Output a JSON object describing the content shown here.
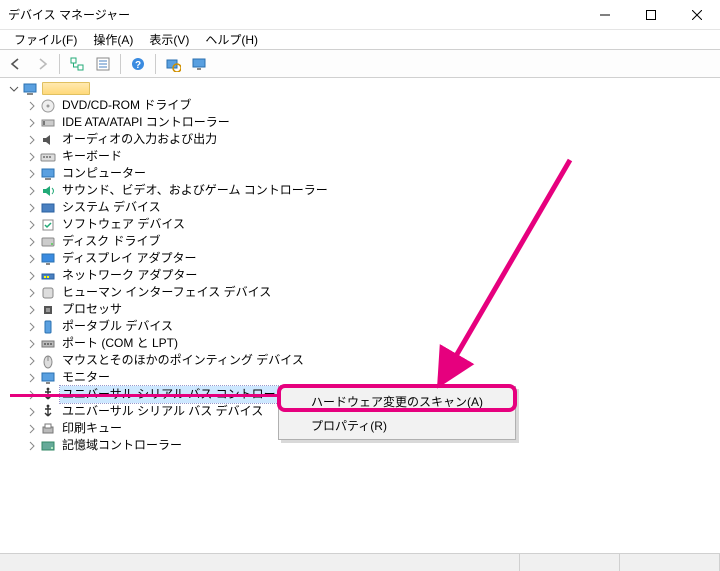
{
  "window": {
    "title": "デバイス マネージャー"
  },
  "menu": {
    "file": "ファイル(F)",
    "action": "操作(A)",
    "view": "表示(V)",
    "help": "ヘルプ(H)"
  },
  "toolbar": {
    "back": "back",
    "forward": "forward",
    "up": "up",
    "show_hidden": "show-hidden",
    "properties": "properties",
    "scan": "scan-hardware",
    "monitor": "monitor"
  },
  "tree": {
    "root": "",
    "items": [
      {
        "label": "DVD/CD-ROM ドライブ",
        "icon": "disc"
      },
      {
        "label": "IDE ATA/ATAPI コントローラー",
        "icon": "ide"
      },
      {
        "label": "オーディオの入力および出力",
        "icon": "audio"
      },
      {
        "label": "キーボード",
        "icon": "keyboard"
      },
      {
        "label": "コンピューター",
        "icon": "computer"
      },
      {
        "label": "サウンド、ビデオ、およびゲーム コントローラー",
        "icon": "sound"
      },
      {
        "label": "システム デバイス",
        "icon": "system"
      },
      {
        "label": "ソフトウェア デバイス",
        "icon": "software"
      },
      {
        "label": "ディスク ドライブ",
        "icon": "disk"
      },
      {
        "label": "ディスプレイ アダプター",
        "icon": "display"
      },
      {
        "label": "ネットワーク アダプター",
        "icon": "network"
      },
      {
        "label": "ヒューマン インターフェイス デバイス",
        "icon": "hid"
      },
      {
        "label": "プロセッサ",
        "icon": "cpu"
      },
      {
        "label": "ポータブル デバイス",
        "icon": "portable"
      },
      {
        "label": "ポート (COM と LPT)",
        "icon": "port"
      },
      {
        "label": "マウスとそのほかのポインティング デバイス",
        "icon": "mouse"
      },
      {
        "label": "モニター",
        "icon": "monitor"
      },
      {
        "label": "ユニバーサル シリアル バス コントローラー",
        "icon": "usb",
        "selected": true
      },
      {
        "label": "ユニバーサル シリアル バス デバイス",
        "icon": "usb"
      },
      {
        "label": "印刷キュー",
        "icon": "printer"
      },
      {
        "label": "記憶域コントローラー",
        "icon": "storage"
      }
    ]
  },
  "context_menu": {
    "scan": "ハードウェア変更のスキャン(A)",
    "properties": "プロパティ(R)"
  },
  "annotation": {
    "color": "#e6007e"
  }
}
